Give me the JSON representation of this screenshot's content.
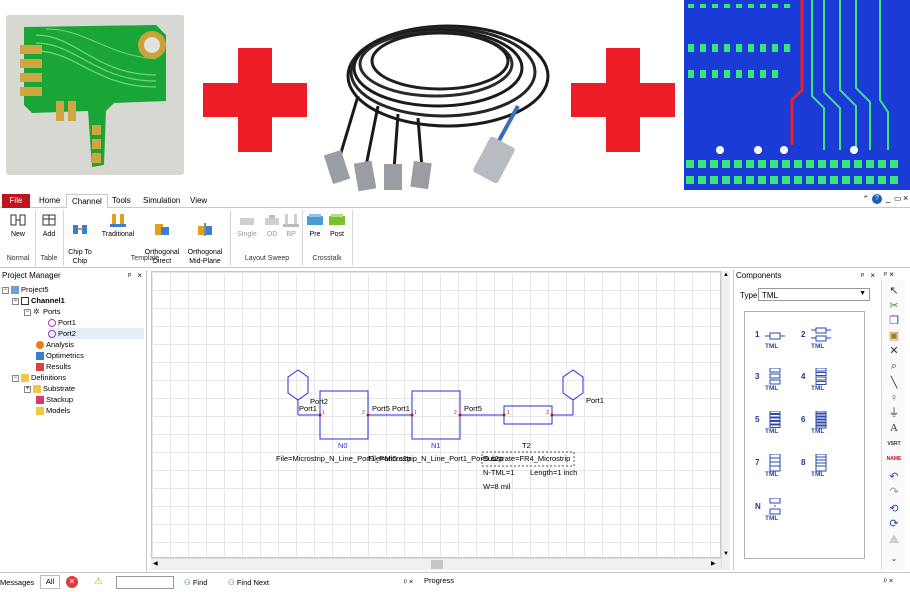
{
  "menu": {
    "file": "File",
    "tabs": [
      "Home",
      "Channel",
      "Tools",
      "Simulation",
      "View"
    ]
  },
  "ribbon": {
    "normal": {
      "new": "New",
      "label": "Normal"
    },
    "table": {
      "add": "Add",
      "label": "Table"
    },
    "template": {
      "items": [
        "Chip To\nChip",
        "Traditional",
        "Orthogonal\nDirect",
        "Orthogonal\nMid-Plane"
      ],
      "label": "Template"
    },
    "layout_sweep": {
      "items": [
        "Single",
        "OD",
        "BP"
      ],
      "label": "Layout Sweep"
    },
    "crosstalk": {
      "items": [
        "Pre",
        "Post"
      ],
      "label": "Crosstalk"
    }
  },
  "project_manager": {
    "title": "Project Manager",
    "tree": {
      "project": "Project5",
      "channel": "Channel1",
      "ports": "Ports",
      "port1": "Port1",
      "port2": "Port2",
      "analysis": "Analysis",
      "optimetrics": "Optimetrics",
      "results": "Results",
      "definitions": "Definitions",
      "substrate": "Substrate",
      "stackup": "Stackup",
      "models": "Models"
    }
  },
  "schematic": {
    "port_left_label": "Port2",
    "port_left_sub": "Port1",
    "n0_right": "Port5",
    "n1_left": "Port1",
    "n1_right": "Port5",
    "port_right_label": "Port1",
    "n0_name": "N0",
    "n1_name": "N1",
    "t2_name": "T2",
    "n0_file": "File=Microstrip_N_Line_Port1_Port5.s2p",
    "n1_file": "File=Microstrip_N_Line_Port1_Port5.s2p",
    "substrate": "Substrate=FR4_Microstrip",
    "ntml": "N-TML=1",
    "length": "Length=1 inch",
    "width": "W=8 mil",
    "pin_numbers": [
      "1",
      "2"
    ]
  },
  "components": {
    "title": "Components",
    "type_label": "Type",
    "type_value": "TML",
    "items": [
      {
        "num": "1",
        "label": "TML"
      },
      {
        "num": "2",
        "label": "TML"
      },
      {
        "num": "3",
        "label": "TML"
      },
      {
        "num": "4",
        "label": "TML"
      },
      {
        "num": "5",
        "label": "TML"
      },
      {
        "num": "6",
        "label": "TML"
      },
      {
        "num": "7",
        "label": "TML"
      },
      {
        "num": "8",
        "label": "TML"
      },
      {
        "num": "N",
        "label": "TML"
      }
    ]
  },
  "toolstrip": {
    "text_tool": "A",
    "vsrc": "VSRT",
    "name": "NAME"
  },
  "bottom": {
    "messages": "Messages",
    "all": "All",
    "find": "Find",
    "find_next": "Find Next",
    "progress": "Progress"
  },
  "colors": {
    "accent_red": "#ee1c24",
    "file_tab": "#c0141c",
    "schematic_blue": "#2b2bdd",
    "pcb_green": "#1aa637",
    "layout_blue": "#1b3bd7"
  }
}
